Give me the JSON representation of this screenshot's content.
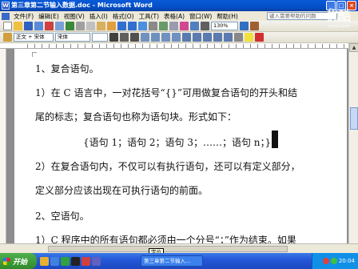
{
  "window": {
    "title": "第三章第二节输入数据.doc - Microsoft Word",
    "help_placeholder": "键入需要帮助的问题"
  },
  "menu": [
    "文件(F)",
    "编辑(E)",
    "视图(V)",
    "插入(I)",
    "格式(O)",
    "工具(T)",
    "表格(A)",
    "窗口(W)",
    "帮助(H)"
  ],
  "toolbar": {
    "zoom": "130%",
    "style": "正文 + 宋体",
    "font": "宋体"
  },
  "document": {
    "paragraphs": [
      "1、复合语句。",
      "1）在 C 语言中，一对花括号“{}”可用做复合语句的开头和结",
      "尾的标志；复合语句也称为语句块。形式如下：",
      "{语句 1；语句 2；语句 3；……；语句 n；}",
      "2）在复合语句内，不仅可以有执行语句，还可以有定义部分，",
      "定义部分应该出现在可执行语句的前面。",
      "2、空语句。",
      "1）C 程序中的所有语句都必须由一个分号“；”作为结束。如果"
    ]
  },
  "tooltip": "定位",
  "taskbar": {
    "start_label": "开始",
    "task_button": "第三章第二节输入...",
    "clock": "20:04"
  },
  "watermark": {
    "main": "优酷",
    "sub": "youku.com"
  },
  "colors": {
    "title_bar": "#0450c8",
    "taskbar": "#2558d8",
    "start_button": "#2f8a2c"
  }
}
